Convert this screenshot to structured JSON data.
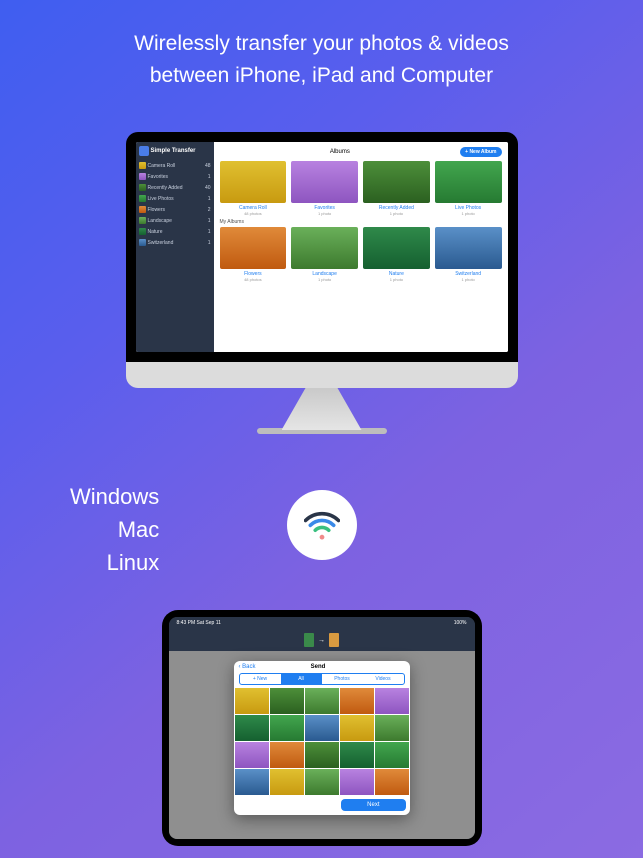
{
  "headline_l1": "Wirelessly transfer your photos & videos",
  "headline_l2": "between iPhone, iPad and Computer",
  "os": {
    "windows": "Windows",
    "mac": "Mac",
    "linux": "Linux"
  },
  "desktop": {
    "app_name": "Simple Transfer",
    "header_title": "Albums",
    "new_album_btn": "+ New Album",
    "my_albums_label": "My Albums",
    "sidebar": [
      {
        "name": "Camera Roll",
        "count": "48"
      },
      {
        "name": "Favorites",
        "count": "1"
      },
      {
        "name": "Recently Added",
        "count": "40"
      },
      {
        "name": "Live Photos",
        "count": "1"
      },
      {
        "name": "Flowers",
        "count": "2"
      },
      {
        "name": "Landscape",
        "count": "1"
      },
      {
        "name": "Nature",
        "count": "1"
      },
      {
        "name": "Switzerland",
        "count": "1"
      }
    ],
    "top_albums": [
      {
        "name": "Camera Roll",
        "sub": "48 photos"
      },
      {
        "name": "Favorites",
        "sub": "1 photo"
      },
      {
        "name": "Recently Added",
        "sub": "1 photo"
      },
      {
        "name": "Live Photos",
        "sub": "1 photo"
      }
    ],
    "my_albums": [
      {
        "name": "Flowers",
        "sub": "48 photos"
      },
      {
        "name": "Landscape",
        "sub": "1 photo"
      },
      {
        "name": "Nature",
        "sub": "1 photo"
      },
      {
        "name": "Switzerland",
        "sub": "1 photo"
      }
    ]
  },
  "ipad": {
    "status_time": "8:43 PM  Sat Sep 11",
    "back": "Back",
    "modal_title": "Send",
    "tabs": [
      "+ New",
      "All",
      "Photos",
      "Videos"
    ],
    "next_btn": "Next"
  }
}
